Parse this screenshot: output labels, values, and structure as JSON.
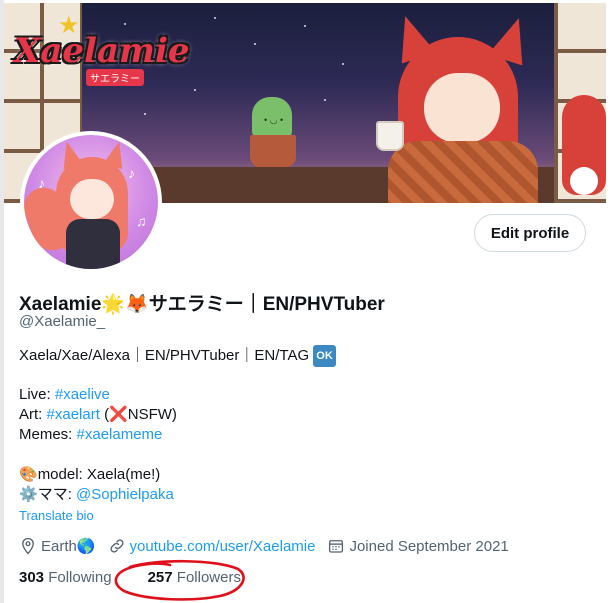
{
  "banner": {
    "logo_text": "Xaelamie",
    "logo_sub": "サエラミー"
  },
  "profile": {
    "edit_button": "Edit profile",
    "display_name": "Xaelamie🌟🦊サエラミー｜EN/PHVTuber",
    "handle": "@Xaelamie_",
    "bio": {
      "line1_text": "Xaela/Xae/Alexa｜EN/PHVTuber｜EN/TAG",
      "line1_badge": "OK",
      "live_label": "Live:",
      "live_tag": "#xaelive",
      "art_label": "Art:",
      "art_tag": "#xaelart",
      "art_note_open": "(",
      "art_note_mark": "❌",
      "art_note_text": "NSFW)",
      "memes_label": "Memes:",
      "memes_tag": "#xaelameme",
      "model_emoji": "🎨",
      "model_text": "model: Xaela(me!)",
      "mama_emoji": "⚙️",
      "mama_label": "ママ:",
      "mama_tag": "@Sophielpaka"
    },
    "translate_link": "Translate bio",
    "meta": {
      "location": "Earth🌎",
      "website": "youtube.com/user/Xaelamie",
      "joined": "Joined September 2021"
    },
    "stats": {
      "following_count": "303",
      "following_label": "Following",
      "followers_count": "257",
      "followers_label": "Followers"
    }
  },
  "colors": {
    "link": "#1d9bf0",
    "text": "#0f1419",
    "secondary": "#536471",
    "annotation_circle": "#e0101a"
  },
  "icons": [
    "location-icon",
    "link-icon",
    "calendar-icon"
  ]
}
